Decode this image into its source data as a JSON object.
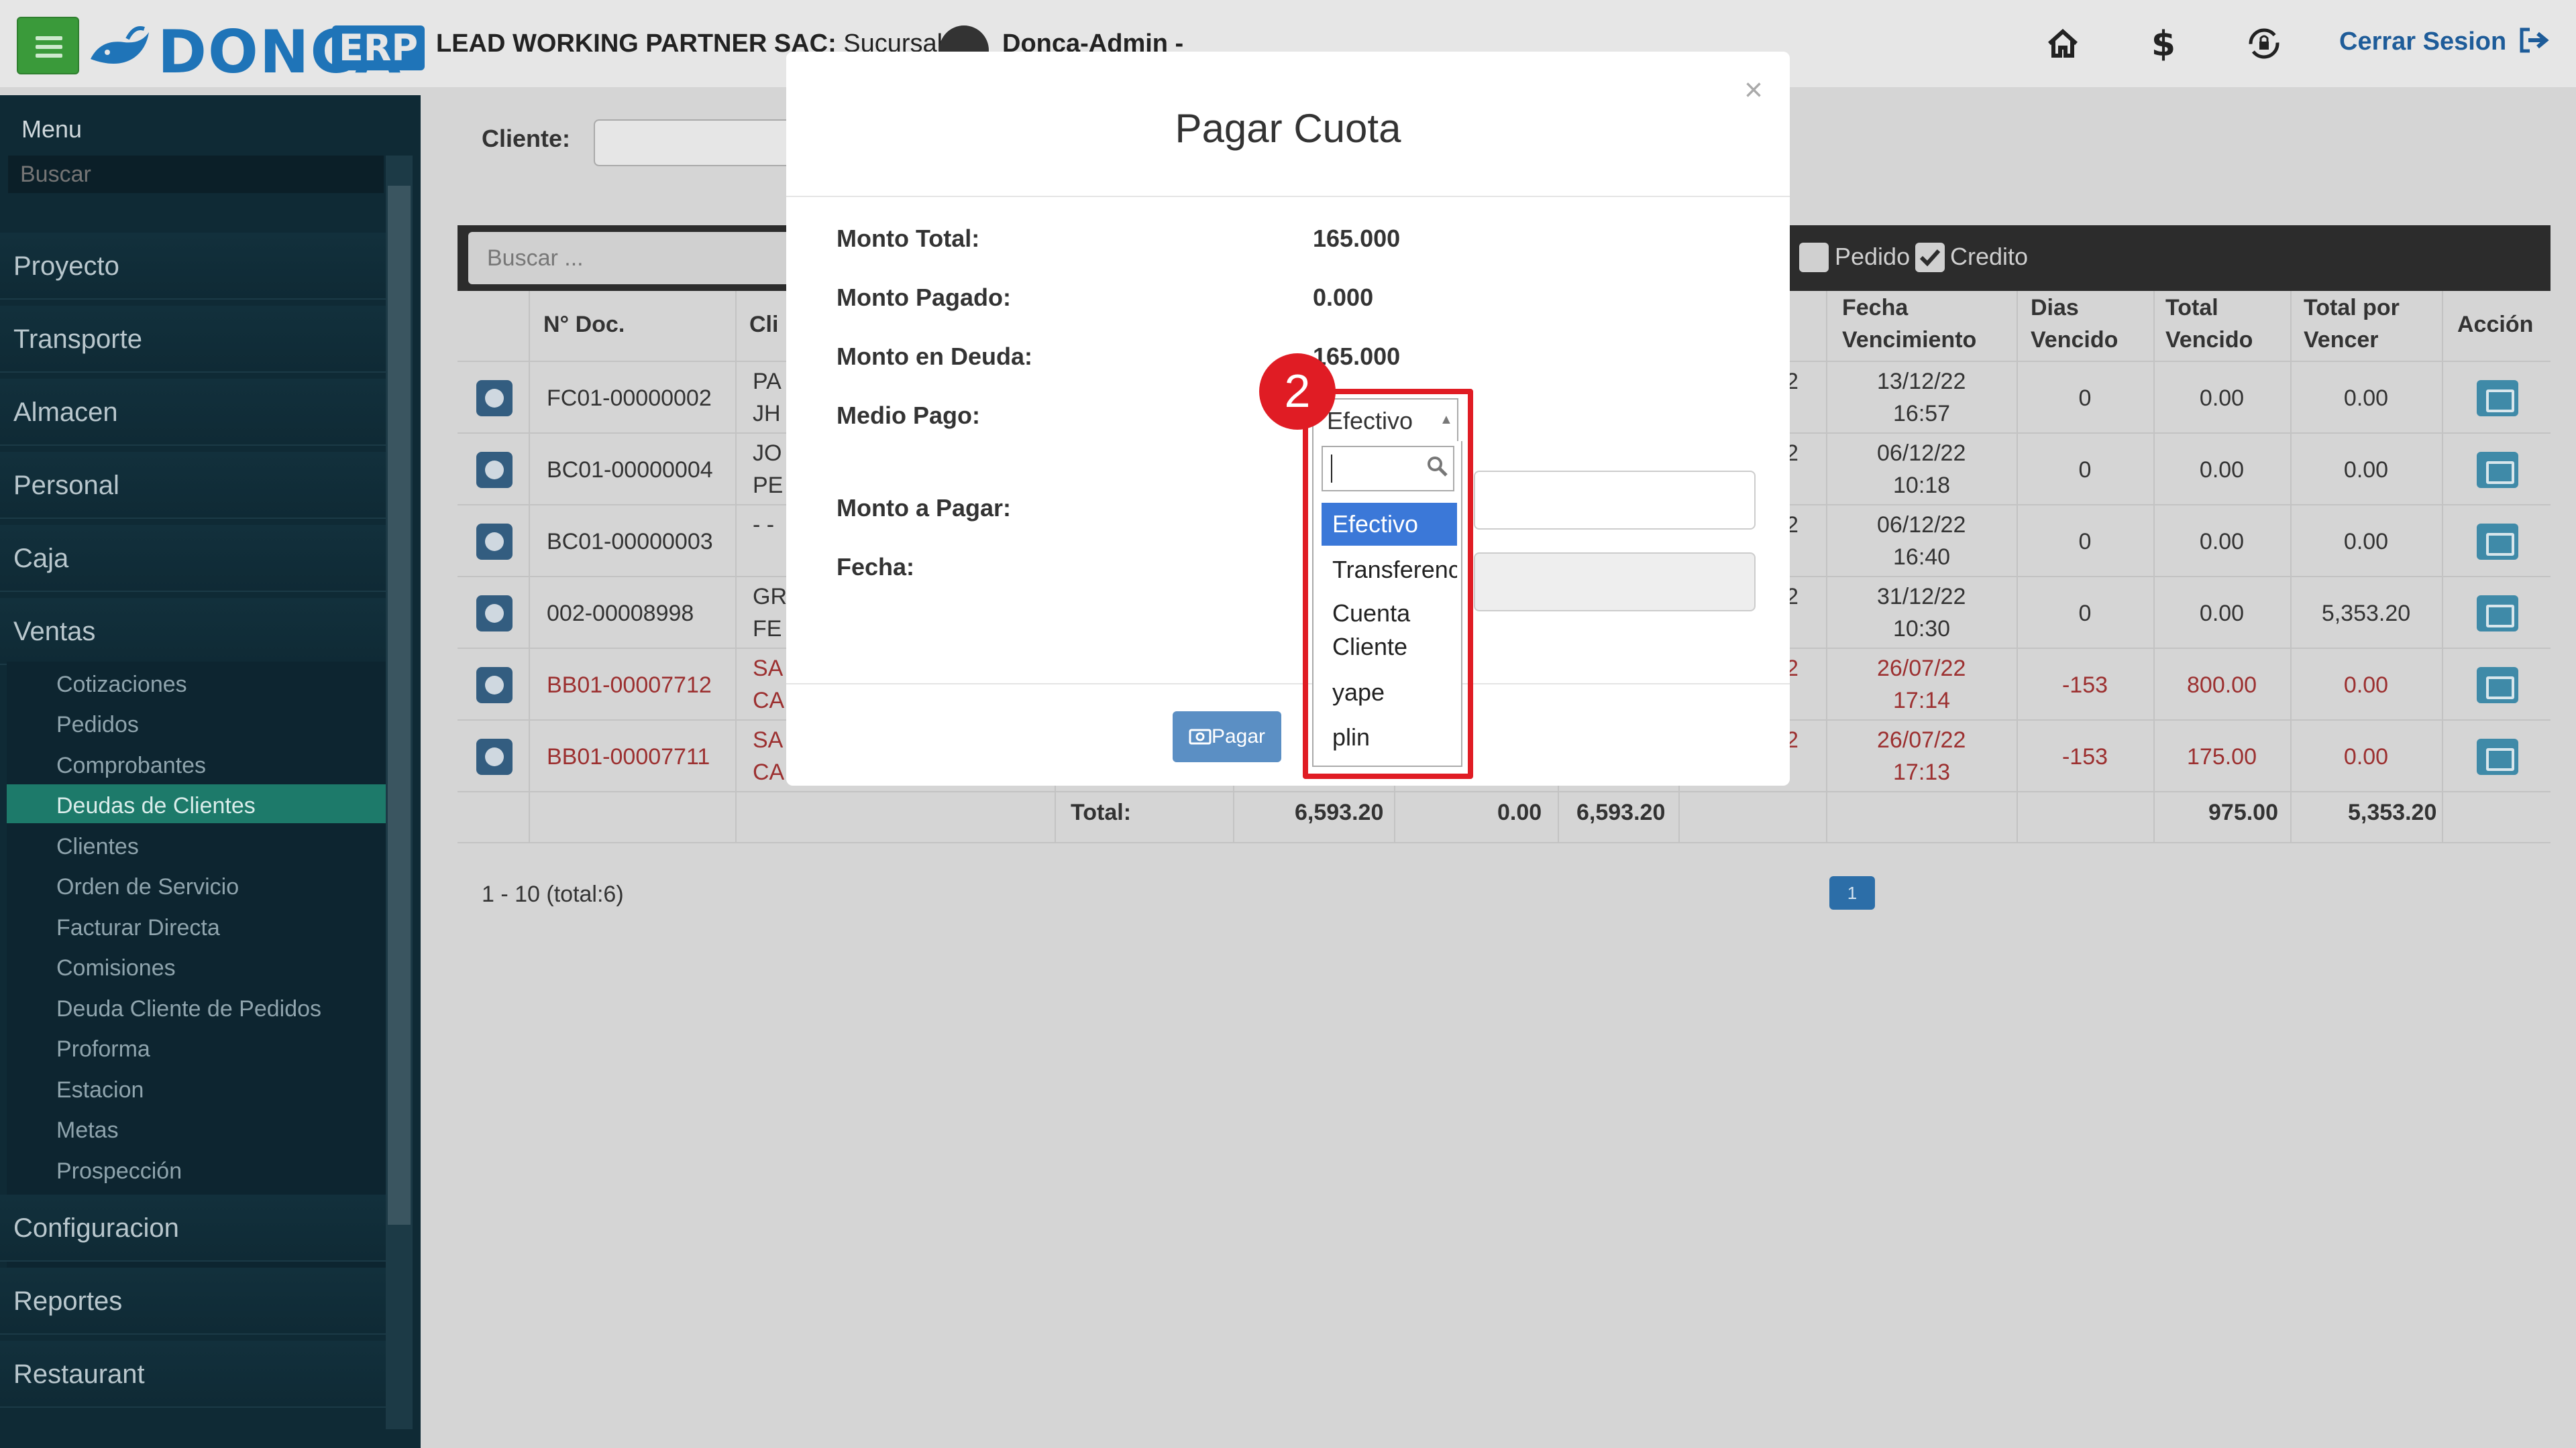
{
  "header": {
    "logo_text": "DONCA",
    "logo_badge": "ERP",
    "company": "LEAD WORKING PARTNER SAC:",
    "branch": " Sucursal k |",
    "user": "Donca-Admin -",
    "logout_label": "Cerrar Sesion",
    "icons": [
      "home-icon",
      "dollar-icon",
      "sync-lock-icon",
      "logout-icon"
    ]
  },
  "sidebar": {
    "title": "Menu",
    "search_placeholder": "Buscar",
    "items": [
      "Proyecto",
      "Transporte",
      "Almacen",
      "Personal",
      "Caja",
      "Ventas"
    ],
    "ventas_sub": [
      "Cotizaciones",
      "Pedidos",
      "Comprobantes",
      "Deudas de Clientes",
      "Clientes",
      "Orden de Servicio",
      "Facturar Directa",
      "Comisiones",
      "Deuda Cliente de Pedidos",
      "Proforma",
      "Estacion",
      "Metas",
      "Prospección"
    ],
    "active_sub": "Deudas de Clientes",
    "bottom_items": [
      "Configuracion",
      "Reportes",
      "Restaurant"
    ]
  },
  "filters": {
    "cliente_label": "Cliente:",
    "search_placeholder": "Buscar ...",
    "pedido_label": "Pedido",
    "credito_label": "Credito",
    "credito_checked": true
  },
  "table": {
    "headers": {
      "ndoc": "N° Doc.",
      "cliente": "Cli",
      "fecha_venc_1": "Fecha",
      "fecha_venc_2": "Vencimiento",
      "dias_1": "Dias",
      "dias_2": "Vencido",
      "total_venc_1": "Total",
      "total_venc_2": "Vencido",
      "total_por_1": "Total por",
      "total_por_2": "Vencer",
      "accion": "Acción"
    },
    "rows": [
      {
        "doc": "FC01-00000002",
        "cli1": "PA",
        "cli2": "JH",
        "edge": "2",
        "fecha1": "13/12/22",
        "fecha2": "16:57",
        "dias": "0",
        "vencido": "0.00",
        "por_vencer": "0.00",
        "overdue": false
      },
      {
        "doc": "BC01-00000004",
        "cli1": "JO",
        "cli2": "PE",
        "edge": "2",
        "fecha1": "06/12/22",
        "fecha2": "10:18",
        "dias": "0",
        "vencido": "0.00",
        "por_vencer": "0.00",
        "overdue": false
      },
      {
        "doc": "BC01-00000003",
        "cli1": "- -",
        "cli2": "",
        "edge": "2",
        "fecha1": "06/12/22",
        "fecha2": "16:40",
        "dias": "0",
        "vencido": "0.00",
        "por_vencer": "0.00",
        "overdue": false
      },
      {
        "doc": "002-00008998",
        "cli1": "GR",
        "cli2": "FE",
        "edge": "2",
        "fecha1": "31/12/22",
        "fecha2": "10:30",
        "dias": "0",
        "vencido": "0.00",
        "por_vencer": "5,353.20",
        "overdue": false
      },
      {
        "doc": "BB01-00007712",
        "cli1": "SA",
        "cli2": "CA",
        "edge": "2",
        "fecha1": "26/07/22",
        "fecha2": "17:14",
        "dias": "-153",
        "vencido": "800.00",
        "por_vencer": "0.00",
        "overdue": true
      },
      {
        "doc": "BB01-00007711",
        "cli1": "SA",
        "cli2": "CA",
        "edge": "2",
        "fecha1": "26/07/22",
        "fecha2": "17:13",
        "dias": "-153",
        "vencido": "175.00",
        "por_vencer": "0.00",
        "overdue": true
      }
    ],
    "totals": {
      "label": "Total:",
      "t1": "6,593.20",
      "t2": "0.00",
      "t3": "6,593.20",
      "vencido": "975.00",
      "por_vencer": "5,353.20"
    },
    "pagination_info": "1 - 10 (total:6)",
    "current_page": "1"
  },
  "modal": {
    "title": "Pagar Cuota",
    "close": "×",
    "monto_total_label": "Monto Total:",
    "monto_total": "165.000",
    "monto_pagado_label": "Monto Pagado:",
    "monto_pagado": "0.000",
    "monto_deuda_label": "Monto en Deuda:",
    "monto_deuda": "165.000",
    "medio_pago_label": "Medio Pago:",
    "monto_pagar_label": "Monto a Pagar:",
    "fecha_label": "Fecha:",
    "pagar_button": "Pagar"
  },
  "medio_pago_select": {
    "selected": "Efectivo",
    "options": [
      "Efectivo",
      "Transferenc",
      "Cuenta Cliente",
      "yape",
      "plin"
    ]
  },
  "annotation": {
    "step": "2",
    "color": "#e01c24"
  },
  "colors": {
    "brand": "#1f74b8",
    "sidebar_bg": "#0f2a35",
    "active_menu": "#1d7a6a",
    "overdue_text": "#9c3030",
    "selected_option": "#3b78d8"
  }
}
